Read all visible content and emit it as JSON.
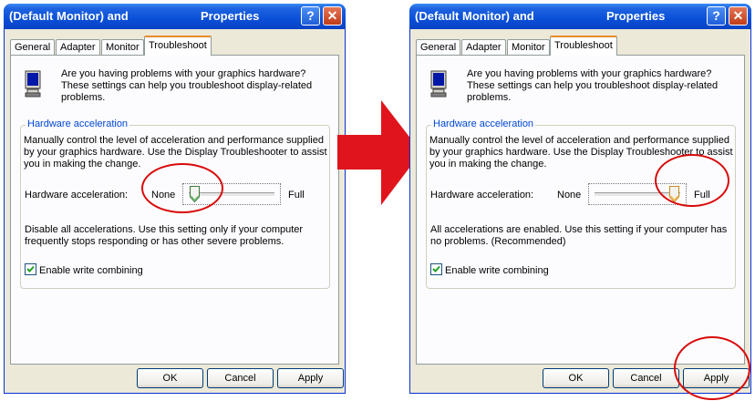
{
  "colors": {
    "callout": "#d90a0a",
    "arrow": "#e0141c",
    "titlebar": "#0a4fd8",
    "group_title": "#0046d5"
  },
  "dialogs": [
    {
      "title_left": "(Default Monitor) and",
      "title_right": "Properties",
      "help_glyph": "?",
      "close_glyph": "✕",
      "tabs": [
        "General",
        "Adapter",
        "Monitor",
        "Troubleshoot"
      ],
      "active_tab": "Troubleshoot",
      "intro_text": "Are you having problems with your graphics hardware? These settings can help you troubleshoot display-related problems.",
      "group_title": "Hardware acceleration",
      "group_desc": "Manually control the level of acceleration and performance supplied by your graphics hardware. Use the Display Troubleshooter to assist you in making the change.",
      "slider_label": "Hardware acceleration:",
      "slider_min_label": "None",
      "slider_max_label": "Full",
      "slider_level": 0,
      "level_description": "Disable all accelerations. Use this setting only if your computer frequently stops responding or has other severe problems.",
      "checkbox_label": "Enable write combining",
      "checkbox_checked": true,
      "buttons": {
        "ok": "OK",
        "cancel": "Cancel",
        "apply": "Apply"
      },
      "icons": [
        "monitor-icon",
        "help-icon",
        "close-icon",
        "checkmark-icon"
      ]
    },
    {
      "title_left": "(Default Monitor) and",
      "title_right": "Properties",
      "help_glyph": "?",
      "close_glyph": "✕",
      "tabs": [
        "General",
        "Adapter",
        "Monitor",
        "Troubleshoot"
      ],
      "active_tab": "Troubleshoot",
      "intro_text": "Are you having problems with your graphics hardware? These settings can help you troubleshoot display-related problems.",
      "group_title": "Hardware acceleration",
      "group_desc": "Manually control the level of acceleration and performance supplied by your graphics hardware. Use the Display Troubleshooter to assist you in making the change.",
      "slider_label": "Hardware acceleration:",
      "slider_min_label": "None",
      "slider_max_label": "Full",
      "slider_level": 1,
      "level_description": "All accelerations are enabled. Use this setting if your computer has no problems. (Recommended)",
      "checkbox_label": "Enable write combining",
      "checkbox_checked": true,
      "buttons": {
        "ok": "OK",
        "cancel": "Cancel",
        "apply": "Apply"
      },
      "icons": [
        "monitor-icon",
        "help-icon",
        "close-icon",
        "checkmark-icon"
      ]
    }
  ]
}
